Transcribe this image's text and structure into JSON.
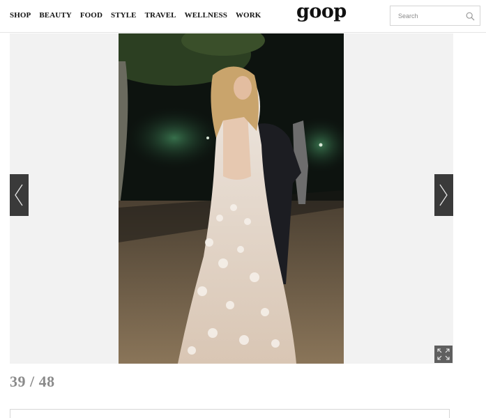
{
  "header": {
    "nav": [
      "SHOP",
      "BEAUTY",
      "FOOD",
      "STYLE",
      "TRAVEL",
      "WELLNESS",
      "WORK"
    ],
    "logo": "goop",
    "search": {
      "placeholder": "Search",
      "icon": "search-icon"
    }
  },
  "gallery": {
    "photo_alt": "Woman in a white lace backless gown on a wooden deck at night",
    "prev_icon": "chevron-left-icon",
    "next_icon": "chevron-right-icon",
    "expand_icon": "expand-icon",
    "counter": "39 / 48"
  },
  "colors": {
    "arrow_bg": "#3a3a3a",
    "gallery_bg": "#f2f2f2",
    "counter": "#8a8a8a"
  }
}
